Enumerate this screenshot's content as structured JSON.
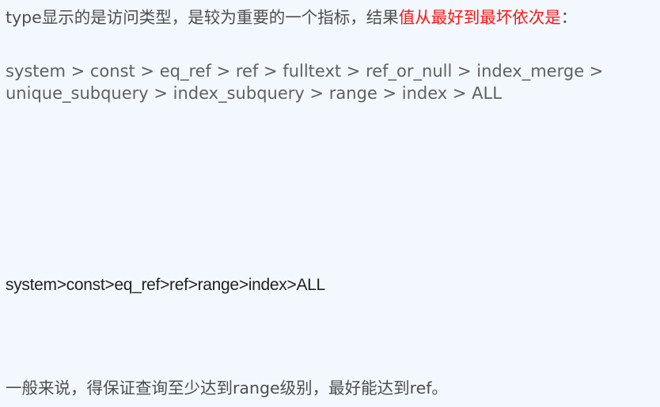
{
  "intro": {
    "text": "type显示的是访问类型，是较为重要的一个指标，结果",
    "emphasis": "值从最好到最坏依次是",
    "colon": "："
  },
  "full_order": {
    "line1": "system > const > eq_ref > ref > fulltext > ref_or_null > index_merge >",
    "line2": "unique_subquery > index_subquery > range > index > ALL"
  },
  "common_order": "system>const>eq_ref>ref>range>index>ALL",
  "conclusion": "一般来说，得保证查询至少达到range级别，最好能达到ref。",
  "colors": {
    "background": "#f2f8fe",
    "emphasis": "#f91616"
  }
}
